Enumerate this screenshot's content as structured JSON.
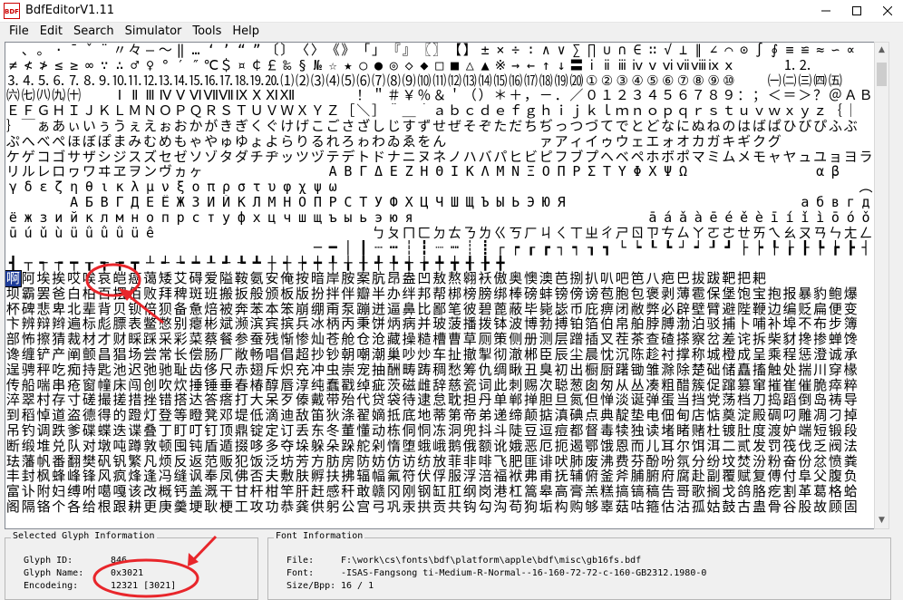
{
  "window": {
    "title": "BdfEditorV1.11",
    "icon_text": "BDF"
  },
  "menu": [
    "File",
    "Edit",
    "Search",
    "Simulator",
    "Tools",
    "Help"
  ],
  "grid": {
    "rows": [
      " 、。·ˉˇ¨〃々—～‖…‘’“”〔〕〈〉《》「」『』〖〗【】±×÷∶∧∨∑∏∪∩∈∷√⊥∥∠⌒⊙∫∮≡≌≈∽∝",
      "≠≮≯≤≥∞∵∴♂♀°′″℃＄¤￠￡‰§№☆★○●◎◇◆□■△▲※→←↑↓〓ⅰⅱⅲⅳⅴⅵⅶⅷⅸⅹ   ⒈⒉",
      "⒊⒋⒌⒍⒎⒏⒐⒑⒒⒓⒔⒕⒖⒗⒘⒙⒚⒛⑴⑵⑶⑷⑸⑹⑺⑻⑼⑽⑾⑿⒀⒁⒂⒃⒄⒅⒆⒇①②③④⑤⑥⑦⑧⑨⑩  ㈠㈡㈢㈣㈤",
      "㈥㈦㈧㈨㈩  ⅠⅡⅢⅣⅤⅥⅦⅧⅨⅩⅪⅫ    ！＂＃￥％＆＇（）＊＋，－．／０１２３４５６７８９：；＜＝＞？＠ＡＢＣＤ",
      "ＥＦＧＨＩＪＫＬＭＮＯＰＱＲＳＴＵＶＷＸＹＺ［＼］＾＿｀ａｂｃｄｅｆｇｈｉｊｋｌｍｎｏｐｑｒｓｔｕｖｗｘｙｚ｛｜",
      "｝￣ぁあぃいぅうぇえぉおかがきぎくぐけげこごさざしじすずせぜそぞただちぢっつづてでとどなにぬねのはばぱひびぴふぶ",
      "ぷへべぺほぼぽまみむめもゃやゅゆょよらりるれろゎわゐゑをん      ァアィイゥウェエォオカガキギクグ",
      "ケゲコゴサザシジスズセゼソゾタダチヂッツヅテデトドナニヌネノハバパヒビピフブプヘベペホボポマミムメモャヤュユョヨラ",
      "リルレロヮワヰヱヲンヴヵヶ        ΑΒΓΔΕΖΗΘΙΚΛΜΝΞΟΠΡΣΤΥΦΧΨΩ        αβ",
      "γδεζηθικλμνξοπρστυφχψω                                  ︵︶",
      "    АБВГДЕЁЖЗИЙКЛМНОПРСТУФХЦЧШЩЪЫЬЭЮЯ               абвгде",
      "ёжзийклмнопрстуфхцчшщъыьэюя               āáǎàēéěèīíǐìōóǒò",
      "ūúǔùǖǘǚǜüê              ㄅㄆㄇㄈㄉㄊㄋㄌㄍㄎㄏㄐㄑㄒㄓㄔㄕㄖㄗㄘㄙㄚㄛㄜㄝㄞㄟㄠㄡㄢㄣㄤㄥㄦㄧㄨㄩ",
      "                    ─━│┃┄┅┆┇┈┉┊┋┌┍┎┏┐┑┒┓└┕┖┗┘┙┚┛├┝┞┟┠┡┢┣┤┥┦┧┨┩┪",
      "┫┬┭┮┯┰┱┲┳┴┵┶┷┸┹┺┻┼┽┾┿╀╁╂╃╄╅╆╇╈╉╊╋                  ",
      "啊阿埃挨哎唉哀皑癌蔼矮艾碍爱隘鞍氨安俺按暗岸胺案肮昂盎凹敖熬翱袄傲奥懊澳芭捌扒叭吧笆八疤巴拔跋靶把耙",
      "坝霸罢爸白柏百摆佰败拜稗斑班搬扳般颁板版扮拌伴瓣半办绊邦帮梆榜膀绑棒磅蚌镑傍谤苞胞包褒剥薄雹保堡饱宝抱报暴豹鲍爆",
      "杯碑悲卑北辈背贝钡倍狈备惫焙被奔苯本笨崩绷甭泵蹦迸逼鼻比鄙笔彼碧蓖蔽毕毙毖币庇痹闭敝弊必辟壁臂避陛鞭边编贬扁便变",
      "卞辨辩辫遍标彪膘表鳖憋别瘪彬斌濒滨宾摈兵冰柄丙秉饼炳病并玻菠播拨钵波博勃搏铂箔伯帛舶脖膊渤泊驳捕卜哺补埠不布步簿",
      "部怖擦猜裁材才财睬踩采彩菜蔡餐参蚕残惭惨灿苍舱仓沧藏操糙槽曹草厕策侧册测层蹭插叉茬茶查碴搽察岔差诧拆柴豺搀掺蝉馋",
      "谗缠铲产阐颤昌猖场尝常长偿肠厂敞畅唱倡超抄钞朝嘲潮巢吵炒车扯撤掣彻澈郴臣辰尘晨忱沉陈趁衬撑称城橙成呈乘程惩澄诚承",
      "逞骋秤吃痴持匙池迟弛驰耻齿侈尺赤翅斥炽充冲虫崇宠抽酬畴踌稠愁筹仇绸瞅丑臭初出橱厨躇锄雏滁除楚础储矗搐触处揣川穿椽",
      "传船喘串疮窗幢床闯创吹炊捶锤垂春椿醇唇淳纯蠢戳绰疵茨磁雌辞慈瓷词此刺赐次聪葱囱匆从丛凑粗醋簇促蹿篡窜摧崔催脆瘁粹",
      "淬翠村存寸磋撮搓措挫错搭达答瘩打大呆歹傣戴带殆代贷袋待逮怠耽担丹单郸掸胆旦氮但惮淡诞弹蛋当挡党荡档刀捣蹈倒岛祷导",
      "到稻悼道盗德得的蹬灯登等瞪凳邓堤低滴迪敌笛狄涤翟嫡抵底地蒂第帝弟递缔颠掂滇碘点典靛垫电佃甸店惦奠淀殿碉叼雕凋刁掉",
      "吊钓调跌爹碟蝶迭谍叠丁盯叮钉顶鼎锭定订丢东冬董懂动栋侗恫冻洞兜抖斗陡豆逗痘都督毒犊独读堵睹赌杜镀肚度渡妒端短锻段",
      "断缎堆兑队对墩吨蹲敦顿囤钝盾遁掇哆多夺垛躲朵跺舵剁惰堕蛾峨鹅俄额讹娥恶厄扼遏鄂饿恩而儿耳尔饵洱二贰发罚筏伐乏阀法",
      "珐藩帆番翻樊矾钒繁凡烦反返范贩犯饭泛坊芳方肪房防妨仿访纺放菲非啡飞肥匪诽吠肺废沸费芬酚吩氛分纷坟焚汾粉奋份忿愤粪",
      "丰封枫蜂峰锋风疯烽逢冯缝讽奉凤佛否夫敷肤孵扶拂辐幅氟符伏俘服浮涪福袱弗甫抚辅俯釜斧脯腑府腐赴副覆赋复傅付阜父腹负",
      "富讣附妇缚咐噶嘎该改概钙盖溉干甘杆柑竿肝赶感秆敢赣冈刚钢缸肛纲岗港杠篙皋高膏羔糕搞镐稿告哥歌搁戈鸽胳疙割革葛格蛤",
      "阁隔铬个各给根跟耕更庚羹埂耿梗工攻功恭龚供躬公宫弓巩汞拱贡共钩勾沟苟狗垢构购够辜菇咕箍估沽孤姑鼓古蛊骨谷股故顾固"
    ],
    "selected": {
      "row": 15,
      "col": 0
    }
  },
  "panels": {
    "selected_title": "Selected Glyph Information",
    "font_title": "Font Information",
    "glyph": [
      {
        "label": "Glyph ID:",
        "value": "846"
      },
      {
        "label": "Glyph Name:",
        "value": "0x3021"
      },
      {
        "label": "Encodeing:",
        "value": "12321 [3021]"
      }
    ],
    "font": [
      {
        "label": "File:",
        "value": "F:\\work\\cs\\fonts\\bdf\\platform\\apple\\bdf\\misc\\gb16fs.bdf"
      },
      {
        "label": "Font:",
        "value": "-ISAS-Fangsong ti-Medium-R-Normal--16-160-72-72-c-160-GB2312.1980-0"
      },
      {
        "label": "Size/Bpp:",
        "value": "16 / 1"
      }
    ]
  },
  "colors": {
    "annotation": "#e8262b",
    "selection": "#1f3d99"
  }
}
